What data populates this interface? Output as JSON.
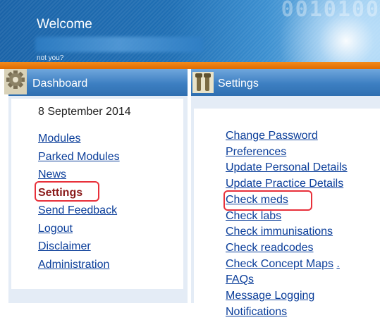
{
  "header": {
    "welcome": "Welcome",
    "not_you": "not you?",
    "binary_text": "0010100"
  },
  "dashboard": {
    "title": "Dashboard",
    "date": "8 September 2014",
    "items": [
      {
        "label": "Modules"
      },
      {
        "label": "Parked Modules"
      },
      {
        "label": "News"
      },
      {
        "label": "Settings",
        "active": true
      },
      {
        "label": "Send Feedback"
      },
      {
        "label": "Logout"
      },
      {
        "label": "Disclaimer"
      },
      {
        "label": "Administration"
      }
    ]
  },
  "settings": {
    "title": "Settings",
    "links": [
      {
        "label": "Change Password"
      },
      {
        "label": "Preferences"
      },
      {
        "label": "Update Personal Details"
      },
      {
        "label": "Update Practice Details"
      },
      {
        "label": "Check meds",
        "highlighted": true
      },
      {
        "label": "Check labs"
      },
      {
        "label": "Check immunisations"
      },
      {
        "label": "Check readcodes"
      },
      {
        "label": "Check Concept Maps",
        "suffix": "."
      },
      {
        "label": "FAQs"
      },
      {
        "label": "Message Logging"
      },
      {
        "label": "Notifications"
      }
    ]
  },
  "colors": {
    "link": "#0b3e9a",
    "active": "#8a1a1a",
    "highlight": "#e8303a",
    "orange_bar": "#f28a1c",
    "panel_header": "#3d7fc2"
  },
  "icons": {
    "dashboard": "gear-icon",
    "settings": "tools-icon"
  }
}
